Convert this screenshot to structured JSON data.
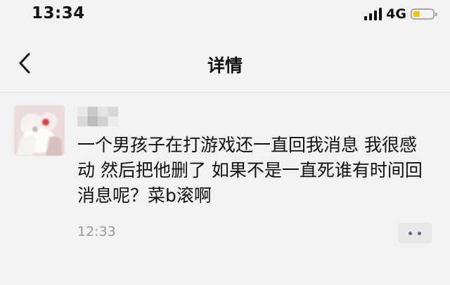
{
  "status_bar": {
    "time": "13:34",
    "network": "4G",
    "battery_level": 0.35,
    "colors": {
      "battery_fill": "#f3c400",
      "battery_outline": "#aaaaaa"
    }
  },
  "navigation": {
    "back_icon": "chevron-left-icon",
    "title": "详情"
  },
  "post": {
    "avatar_icon": "blurred-avatar-icon",
    "username_icon": "mosaic-username-icon",
    "content": "一个男孩子在打游戏还一直回我消息 我很感动 然后把他删了 如果不是一直死谁有时间回消息呢？菜b滚啊",
    "time": "12:33",
    "more_icon": "two-dot-menu-icon"
  },
  "colors": {
    "background": "#f2f2f2",
    "text": "#111111",
    "muted_text": "#9a9a9a",
    "accent": "#566a8f"
  }
}
